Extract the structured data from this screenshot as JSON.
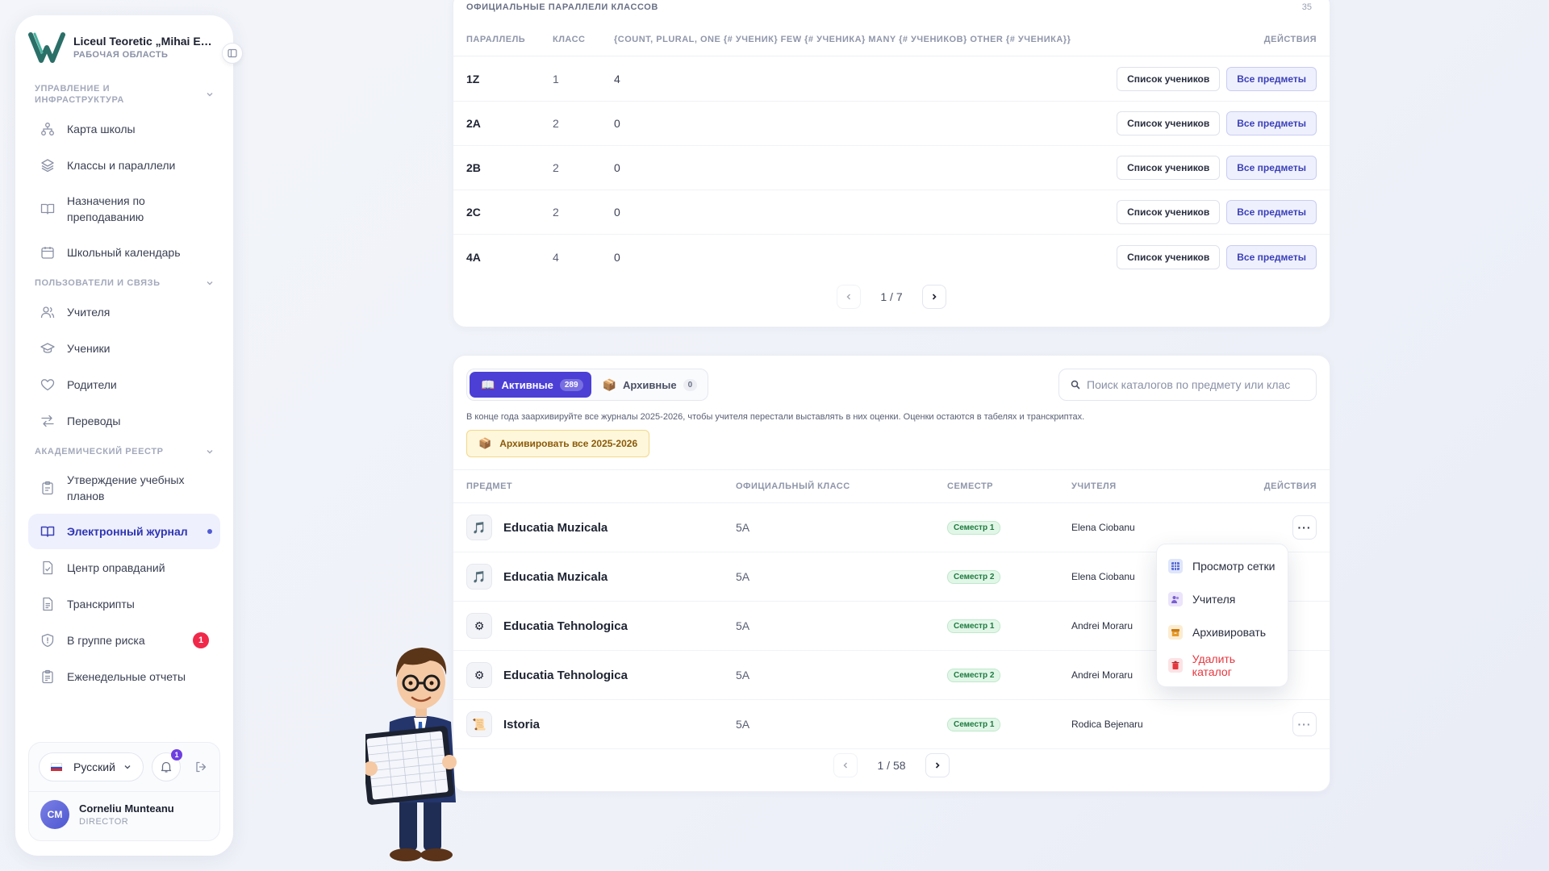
{
  "sidebar": {
    "brand_title": "Liceul Teoretic „Mihai Emi...",
    "brand_sub": "РАБОЧАЯ ОБЛАСТЬ",
    "sections": [
      {
        "title": "УПРАВЛЕНИЕ И ИНФРАСТРУКТУРА",
        "items": [
          {
            "label": "Карта школы",
            "icon": "sitemap-icon"
          },
          {
            "label": "Классы и параллели",
            "icon": "layers-icon"
          },
          {
            "label": "Назначения по преподаванию",
            "icon": "book-open-icon"
          },
          {
            "label": "Школьный календарь",
            "icon": "calendar-icon"
          }
        ]
      },
      {
        "title": "ПОЛЬЗОВАТЕЛИ И СВЯЗЬ",
        "items": [
          {
            "label": "Учителя",
            "icon": "users-icon"
          },
          {
            "label": "Ученики",
            "icon": "graduation-cap-icon"
          },
          {
            "label": "Родители",
            "icon": "heart-icon"
          },
          {
            "label": "Переводы",
            "icon": "transfer-icon"
          }
        ]
      },
      {
        "title": "АКАДЕМИЧЕСКИЙ РЕЕСТР",
        "items": [
          {
            "label": "Утверждение учебных планов",
            "icon": "clipboard-icon"
          },
          {
            "label": "Электронный журнал",
            "icon": "book-icon",
            "active": true
          },
          {
            "label": "Центр оправданий",
            "icon": "file-check-icon"
          },
          {
            "label": "Транскрипты",
            "icon": "file-text-icon"
          },
          {
            "label": "В группе риска",
            "icon": "shield-icon",
            "badge": "1"
          },
          {
            "label": "Еженедельные отчеты",
            "icon": "report-icon"
          }
        ]
      }
    ],
    "language": "Русский",
    "notification_count": "1",
    "user": {
      "initials": "CM",
      "name": "Corneliu Munteanu",
      "role": "DIRECTOR"
    }
  },
  "classes_card": {
    "partial_title": "ОФИЦИАЛЬНЫЕ ПАРАЛЛЕЛИ КЛАССОВ",
    "partial_count": "35",
    "headers": [
      "ПАРАЛЛЕЛЬ",
      "КЛАСС",
      "{COUNT, PLURAL, ONE {# УЧЕНИК} FEW {# УЧЕНИКА} MANY {# УЧЕНИКОВ} OTHER {# УЧЕНИКА}}",
      "ДЕЙСТВИЯ"
    ],
    "rows": [
      {
        "parallel": "1Z",
        "grade": "1",
        "count": "4"
      },
      {
        "parallel": "2A",
        "grade": "2",
        "count": "0"
      },
      {
        "parallel": "2B",
        "grade": "2",
        "count": "0"
      },
      {
        "parallel": "2C",
        "grade": "2",
        "count": "0"
      },
      {
        "parallel": "4A",
        "grade": "4",
        "count": "0"
      }
    ],
    "btn_students": "Список учеников",
    "btn_subjects": "Все предметы",
    "pagination": "1 / 7"
  },
  "catalog_card": {
    "tabs": [
      {
        "label": "Активные",
        "count": "289",
        "icon": "📖"
      },
      {
        "label": "Архивные",
        "count": "0",
        "icon": "📦"
      }
    ],
    "search_placeholder": "Поиск каталогов по предмету или клас",
    "info_text": "В конце года заархивируйте все журналы 2025-2026, чтобы учителя перестали выставлять в них оценки. Оценки остаются в табелях и транскриптах.",
    "archive_all_label": "Архивировать все 2025-2026",
    "headers": [
      "ПРЕДМЕТ",
      "ОФИЦИАЛЬНЫЙ КЛАСС",
      "СЕМЕСТР",
      "УЧИТЕЛЯ",
      "ДЕЙСТВИЯ"
    ],
    "rows": [
      {
        "subject": "Educatia Muzicala",
        "icon": "🎵",
        "class": "5A",
        "semester": "Семестр 1",
        "teacher": "Elena Ciobanu"
      },
      {
        "subject": "Educatia Muzicala",
        "icon": "🎵",
        "class": "5A",
        "semester": "Семестр 2",
        "teacher": "Elena Ciobanu"
      },
      {
        "subject": "Educatia Tehnologica",
        "icon": "⚙",
        "class": "5A",
        "semester": "Семестр 1",
        "teacher": "Andrei Moraru"
      },
      {
        "subject": "Educatia Tehnologica",
        "icon": "⚙",
        "class": "5A",
        "semester": "Семестр 2",
        "teacher": "Andrei Moraru"
      },
      {
        "subject": "Istoria",
        "icon": "📜",
        "class": "5A",
        "semester": "Семестр 1",
        "teacher": "Rodica Bejenaru"
      }
    ],
    "pagination": "1 / 58"
  },
  "context_menu": {
    "items": [
      {
        "label": "Просмотр сетки",
        "icon": "grid-icon",
        "color": "#5b6fd6"
      },
      {
        "label": "Учителя",
        "icon": "teachers-icon",
        "color": "#7a5fd0"
      },
      {
        "label": "Архивировать",
        "icon": "archive-box-icon",
        "color": "#e59a2a"
      },
      {
        "label": "Удалить каталог",
        "icon": "trash-icon",
        "color": "#e5373f",
        "danger": true
      }
    ]
  },
  "colors": {
    "accent": "#4b3fd6",
    "danger": "#e5373f",
    "success": "#1c7a3e"
  }
}
